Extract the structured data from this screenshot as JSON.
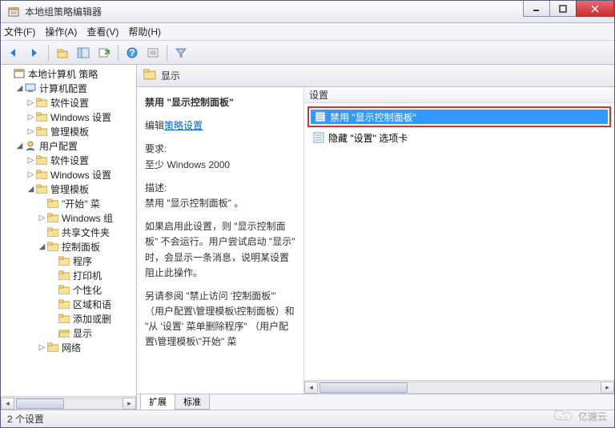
{
  "window": {
    "title": "本地组策略编辑器"
  },
  "menu": {
    "file": "文件(F)",
    "action": "操作(A)",
    "view": "查看(V)",
    "help": "帮助(H)"
  },
  "tree": {
    "root": "本地计算机 策略",
    "computer": "计算机配置",
    "c_software": "软件设置",
    "c_windows": "Windows 设置",
    "c_admin": "管理模板",
    "user": "用户配置",
    "u_software": "软件设置",
    "u_windows": "Windows 设置",
    "u_admin": "管理模板",
    "start": "\"开始\" 菜",
    "win_comp": "Windows 组",
    "shared": "共享文件夹",
    "control_panel": "控制面板",
    "programs": "程序",
    "printers": "打印机",
    "personalize": "个性化",
    "region": "区域和语",
    "addremove": "添加或删",
    "display": "显示",
    "network": "网络"
  },
  "content": {
    "header": "显示",
    "setting_title": "禁用 \"显示控制面板\"",
    "edit_prefix": "编辑",
    "edit_link": "策略设置",
    "req_label": "要求:",
    "req_value": "至少 Windows 2000",
    "desc_label": "描述:",
    "desc_line1": "禁用 \"显示控制面板\" 。",
    "desc_p2": "如果启用此设置，则 \"显示控制面板\" 不会运行。用户尝试启动 \"显示\" 时，会显示一条消息，说明某设置阻止此操作。",
    "desc_p3": "另请参阅 \"禁止访问 '控制面板'\" （用户配置\\管理模板\\控制面板）和 \"从 '设置' 菜单删除程序\" （用户配置\\管理模板\\\"开始\" 菜"
  },
  "list": {
    "col_setting": "设置",
    "item_disable_display": "禁用 \"显示控制面板\"",
    "item_hide_settings": "隐藏 \"设置\" 选项卡"
  },
  "tabs": {
    "extended": "扩展",
    "standard": "标准"
  },
  "status": {
    "text": "2 个设置"
  },
  "watermark": "亿速云"
}
